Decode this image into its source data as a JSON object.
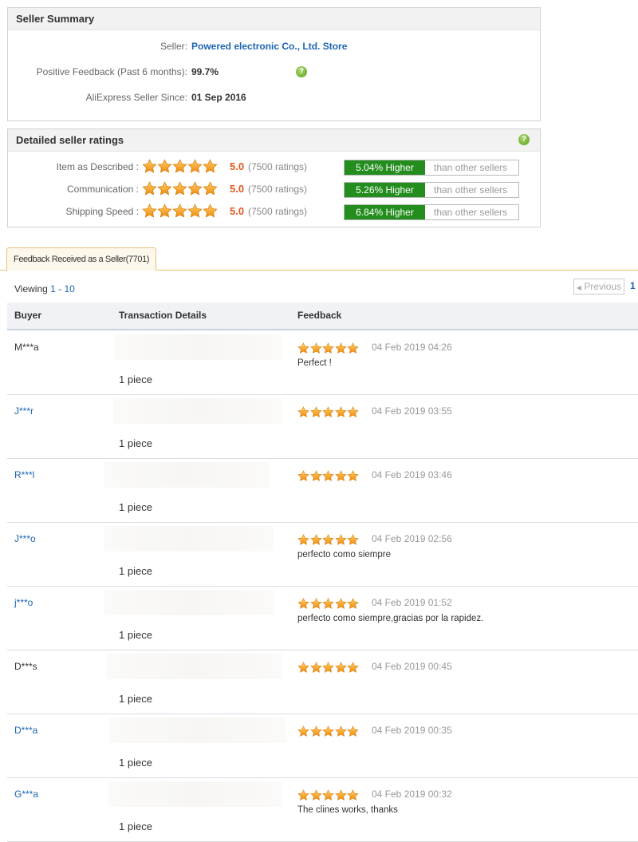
{
  "seller_summary": {
    "title": "Seller Summary",
    "seller_label": "Seller:",
    "seller_name": "Powered electronic Co., Ltd. Store",
    "feedback_label": "Positive Feedback (Past 6 months):",
    "feedback_value": "99.7%",
    "since_label": "AliExpress Seller Since:",
    "since_value": "01 Sep 2016",
    "help_icon": "question-icon"
  },
  "detailed_ratings": {
    "title": "Detailed seller ratings",
    "rows": [
      {
        "label": "Item as Described :",
        "score": "5.0",
        "count": "(7500 ratings)",
        "higher": "5.04% Higher",
        "than": "than other sellers"
      },
      {
        "label": "Communication :",
        "score": "5.0",
        "count": "(7500 ratings)",
        "higher": "5.26% Higher",
        "than": "than other sellers"
      },
      {
        "label": "Shipping Speed :",
        "score": "5.0",
        "count": "(7500 ratings)",
        "higher": "6.84% Higher",
        "than": "than other sellers"
      }
    ],
    "star_rating": 5
  },
  "tab": {
    "label": "Feedback Received as a Seller(7701)"
  },
  "pagination": {
    "viewing_prefix": "Viewing",
    "range": "1 - 10",
    "prev_label": "Previous",
    "page": "1"
  },
  "table": {
    "headers": {
      "buyer": "Buyer",
      "transaction": "Transaction Details",
      "feedback": "Feedback"
    },
    "rows": [
      {
        "buyer": "M***a",
        "link": false,
        "qty": "1 piece",
        "date": "04 Feb 2019 04:26",
        "comment": "Perfect !",
        "stars": 5
      },
      {
        "buyer": "J***r",
        "link": true,
        "qty": "1 piece",
        "date": "04 Feb 2019 03:55",
        "comment": "",
        "stars": 5
      },
      {
        "buyer": "R***l",
        "link": true,
        "qty": "1 piece",
        "date": "04 Feb 2019 03:46",
        "comment": "",
        "stars": 5
      },
      {
        "buyer": "J***o",
        "link": true,
        "qty": "1 piece",
        "date": "04 Feb 2019 02:56",
        "comment": "perfecto como siempre",
        "stars": 5
      },
      {
        "buyer": "j***o",
        "link": true,
        "qty": "1 piece",
        "date": "04 Feb 2019 01:52",
        "comment": "perfecto como siempre,gracias por la rapidez.",
        "stars": 5
      },
      {
        "buyer": "D***s",
        "link": false,
        "qty": "1 piece",
        "date": "04 Feb 2019 00:45",
        "comment": "",
        "stars": 5
      },
      {
        "buyer": "D***a",
        "link": true,
        "qty": "1 piece",
        "date": "04 Feb 2019 00:35",
        "comment": "",
        "stars": 5
      },
      {
        "buyer": "G***a",
        "link": true,
        "qty": "1 piece",
        "date": "04 Feb 2019 00:32",
        "comment": "The clines works, thanks",
        "stars": 5
      }
    ]
  },
  "colors": {
    "accent_green": "#238e1e",
    "link_blue": "#1c64b3",
    "score_orange": "#e5561e",
    "star": "#f39c12"
  }
}
